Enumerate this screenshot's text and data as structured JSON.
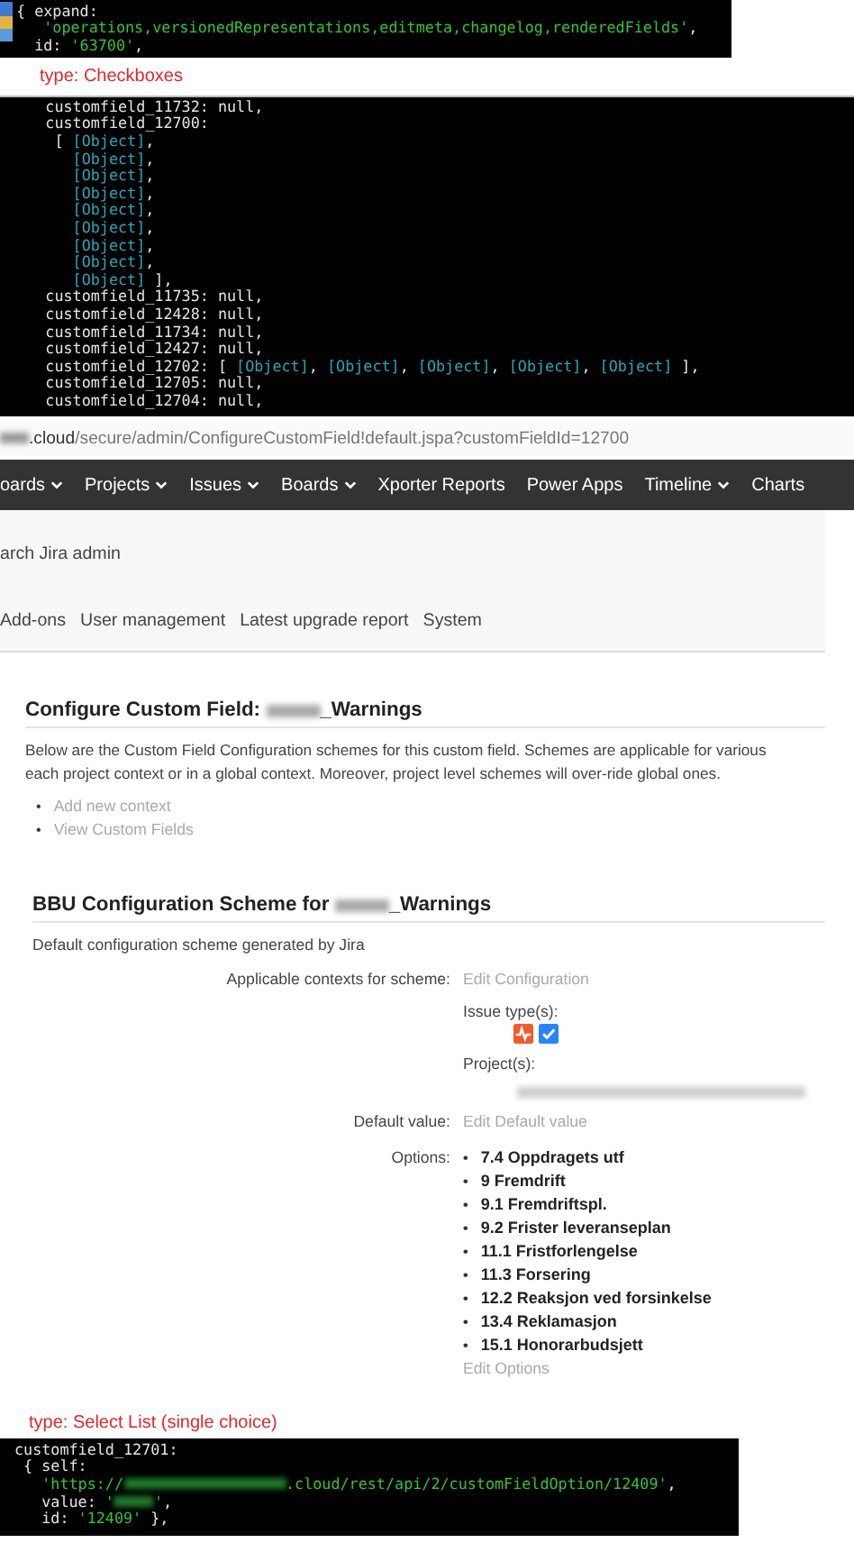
{
  "console_top": {
    "lines": [
      {
        "kind": "root",
        "tokens": [
          {
            "kind": "plain",
            "text": "{ expand:"
          }
        ]
      },
      {
        "kind": "value",
        "tokens": [
          {
            "kind": "string",
            "text": "'operations,versionedRepresentations,editmeta,changelog,renderedFields'"
          },
          {
            "kind": "plain",
            "text": ","
          }
        ]
      },
      {
        "kind": "member",
        "tokens": [
          {
            "kind": "plain",
            "text": "id: "
          },
          {
            "kind": "string",
            "text": "'63700'"
          },
          {
            "kind": "plain",
            "text": ","
          }
        ]
      }
    ]
  },
  "annotation_checkboxes": "type: Checkboxes",
  "console_middle": {
    "lines": [
      {
        "kind": "field",
        "tokens": [
          {
            "kind": "plain",
            "text": "customfield_11732: null,"
          }
        ]
      },
      {
        "kind": "field",
        "tokens": [
          {
            "kind": "plain",
            "text": "customfield_12700:"
          }
        ]
      },
      {
        "kind": "array",
        "tokens": [
          {
            "kind": "plain",
            "text": "[ "
          },
          {
            "kind": "ref",
            "text": "[Object]"
          },
          {
            "kind": "plain",
            "text": ","
          }
        ]
      },
      {
        "kind": "element",
        "tokens": [
          {
            "kind": "ref",
            "text": "[Object]"
          },
          {
            "kind": "plain",
            "text": ","
          }
        ]
      },
      {
        "kind": "element",
        "tokens": [
          {
            "kind": "ref",
            "text": "[Object]"
          },
          {
            "kind": "plain",
            "text": ","
          }
        ]
      },
      {
        "kind": "element",
        "tokens": [
          {
            "kind": "ref",
            "text": "[Object]"
          },
          {
            "kind": "plain",
            "text": ","
          }
        ]
      },
      {
        "kind": "element",
        "tokens": [
          {
            "kind": "ref",
            "text": "[Object]"
          },
          {
            "kind": "plain",
            "text": ","
          }
        ]
      },
      {
        "kind": "element",
        "tokens": [
          {
            "kind": "ref",
            "text": "[Object]"
          },
          {
            "kind": "plain",
            "text": ","
          }
        ]
      },
      {
        "kind": "element",
        "tokens": [
          {
            "kind": "ref",
            "text": "[Object]"
          },
          {
            "kind": "plain",
            "text": ","
          }
        ]
      },
      {
        "kind": "element",
        "tokens": [
          {
            "kind": "ref",
            "text": "[Object]"
          },
          {
            "kind": "plain",
            "text": ","
          }
        ]
      },
      {
        "kind": "element",
        "tokens": [
          {
            "kind": "ref",
            "text": "[Object]"
          },
          {
            "kind": "plain",
            "text": " ],"
          }
        ]
      },
      {
        "kind": "field",
        "tokens": [
          {
            "kind": "plain",
            "text": "customfield_11735: null,"
          }
        ]
      },
      {
        "kind": "field",
        "tokens": [
          {
            "kind": "plain",
            "text": "customfield_12428: null,"
          }
        ]
      },
      {
        "kind": "field",
        "tokens": [
          {
            "kind": "plain",
            "text": "customfield_11734: null,"
          }
        ]
      },
      {
        "kind": "field",
        "tokens": [
          {
            "kind": "plain",
            "text": "customfield_12427: null,"
          }
        ]
      },
      {
        "kind": "field",
        "tokens": [
          {
            "kind": "plain",
            "text": "customfield_12702: [ "
          },
          {
            "kind": "ref",
            "text": "[Object]"
          },
          {
            "kind": "plain",
            "text": ", "
          },
          {
            "kind": "ref",
            "text": "[Object]"
          },
          {
            "kind": "plain",
            "text": ", "
          },
          {
            "kind": "ref",
            "text": "[Object]"
          },
          {
            "kind": "plain",
            "text": ", "
          },
          {
            "kind": "ref",
            "text": "[Object]"
          },
          {
            "kind": "plain",
            "text": ", "
          },
          {
            "kind": "ref",
            "text": "[Object]"
          },
          {
            "kind": "plain",
            "text": " ],"
          }
        ]
      },
      {
        "kind": "field",
        "tokens": [
          {
            "kind": "plain",
            "text": "customfield_12705: null,"
          }
        ]
      },
      {
        "kind": "field",
        "tokens": [
          {
            "kind": "plain",
            "text": "customfield_12704: null,"
          }
        ]
      }
    ]
  },
  "browser": {
    "url": {
      "host": ".cloud",
      "path": "/secure/admin/ConfigureCustomField!default.jspa?customFieldId=12700"
    },
    "nav_items": [
      {
        "label": "oards",
        "dropdown": true
      },
      {
        "label": "Projects",
        "dropdown": true
      },
      {
        "label": "Issues",
        "dropdown": true
      },
      {
        "label": "Boards",
        "dropdown": true
      },
      {
        "label": "Xporter Reports",
        "dropdown": false
      },
      {
        "label": "Power Apps",
        "dropdown": false
      },
      {
        "label": "Timeline",
        "dropdown": true
      },
      {
        "label": "Charts",
        "dropdown": false
      }
    ],
    "search_text": "arch Jira admin",
    "admin_tabs": [
      "Add-ons",
      "User management",
      "Latest upgrade report",
      "System"
    ],
    "heading": {
      "prefix": "Configure Custom Field: ",
      "redacted": true,
      "suffix": "_Warnings"
    },
    "description_lines": [
      "Below are the Custom Field Configuration schemes for this custom field. Schemes are applicable for various",
      "each project context or in a global context. Moreover, project level schemes will over-ride global ones."
    ],
    "links": [
      {
        "bullet": "•",
        "text": "Add new context"
      },
      {
        "bullet": "•",
        "text": "View Custom Fields"
      }
    ],
    "scheme": {
      "heading": {
        "prefix": "BBU Configuration Scheme for ",
        "redacted": true,
        "suffix": "_Warnings"
      },
      "description": "Default configuration scheme generated by Jira",
      "contexts_label": "Applicable contexts for scheme:",
      "edit_configuration": "Edit Configuration",
      "issue_types_label": "Issue type(s):",
      "issue_type_icons": [
        {
          "kind": "pulse",
          "color": "#f15a2b"
        },
        {
          "kind": "check",
          "color": "#2684ff"
        }
      ],
      "projects_label": "Project(s):",
      "projects_redacted": true,
      "default_label": "Default value:",
      "edit_default": "Edit Default value",
      "options_label": "Options:",
      "options": [
        {
          "bullet": "•",
          "text": "7.4 Oppdragets utf"
        },
        {
          "bullet": "•",
          "text": "9 Fremdrift"
        },
        {
          "bullet": "•",
          "text": "9.1 Fremdriftspl."
        },
        {
          "bullet": "•",
          "text": "9.2 Frister leveranseplan"
        },
        {
          "bullet": "•",
          "text": "11.1 Fristforlengelse"
        },
        {
          "bullet": "•",
          "text": "11.3 Forsering"
        },
        {
          "bullet": "•",
          "text": "12.2 Reaksjon ved forsinkelse"
        },
        {
          "bullet": "•",
          "text": "13.4 Reklamasjon"
        },
        {
          "bullet": "•",
          "text": "15.1 Honorarbudsjett"
        }
      ],
      "edit_options": "Edit Options"
    }
  },
  "annotation_select": "type: Select List (single choice)",
  "console_bottom": {
    "lines": [
      {
        "kind": "root",
        "tokens": [
          {
            "kind": "plain",
            "text": "customfield_12701:"
          }
        ]
      },
      {
        "kind": "object",
        "tokens": [
          {
            "kind": "plain",
            "text": "{ self:"
          }
        ]
      },
      {
        "kind": "value",
        "tokens": [
          {
            "kind": "string",
            "text": "'https://"
          },
          {
            "kind": "hostmask"
          },
          {
            "kind": "string",
            "text": ".cloud/rest/api/2/customFieldOption/12409'"
          },
          {
            "kind": "plain",
            "text": ","
          }
        ]
      },
      {
        "kind": "value",
        "tokens": [
          {
            "kind": "plain",
            "text": "value: "
          },
          {
            "kind": "string",
            "text": "'"
          },
          {
            "kind": "valuemask"
          },
          {
            "kind": "string",
            "text": "'"
          },
          {
            "kind": "plain",
            "text": ","
          }
        ]
      },
      {
        "kind": "value",
        "tokens": [
          {
            "kind": "plain",
            "text": "id: "
          },
          {
            "kind": "string",
            "text": "'12409'"
          },
          {
            "kind": "plain",
            "text": " },"
          }
        ]
      }
    ]
  }
}
